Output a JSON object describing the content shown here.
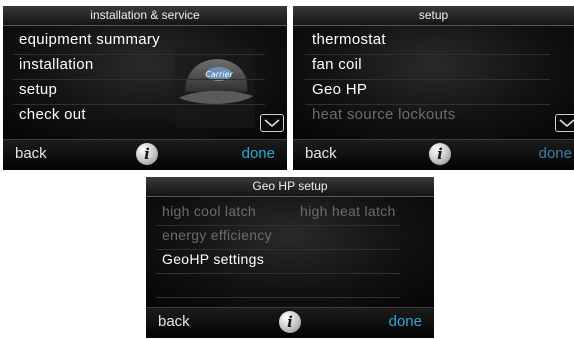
{
  "screens": {
    "installation": {
      "title": "installation & service",
      "items": [
        "equipment summary",
        "installation",
        "setup",
        "check out"
      ],
      "back_label": "back",
      "done_label": "done",
      "info_glyph": "i"
    },
    "setup": {
      "title": "setup",
      "items": [
        "thermostat",
        "fan coil",
        "Geo HP",
        "heat source lockouts"
      ],
      "back_label": "back",
      "done_label": "done",
      "info_glyph": "i"
    },
    "geohp": {
      "title": "Geo HP setup",
      "item_left_1": "high cool latch",
      "item_right_1": "high heat latch",
      "item_2": "energy efficiency",
      "item_3": "GeoHP settings",
      "back_label": "back",
      "done_label": "done",
      "info_glyph": "i"
    }
  },
  "colors": {
    "done_active": "#2fa6d9",
    "done_inactive": "#3a7fa4",
    "disabled_text": "#6c6c6c"
  },
  "icons": [
    "cap-logo-icon",
    "chevron-down-icon",
    "info-icon"
  ]
}
